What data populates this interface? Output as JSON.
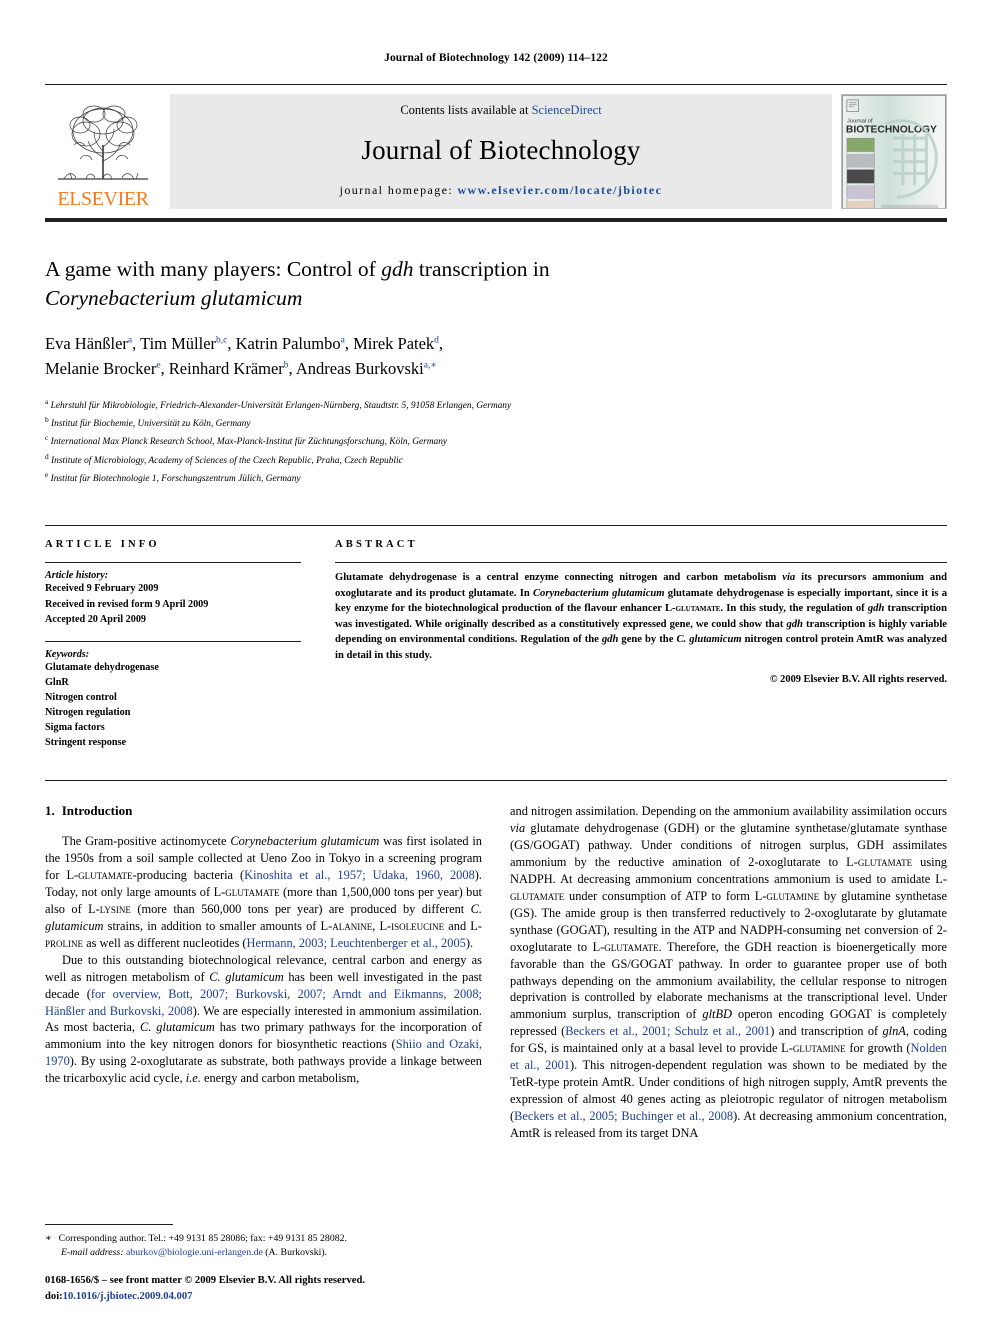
{
  "running_head": "Journal of Biotechnology 142 (2009) 114–122",
  "masthead": {
    "publisher_name": "ELSEVIER",
    "contents_prefix": "Contents lists available at ",
    "contents_link": "ScienceDirect",
    "journal_title": "Journal of Biotechnology",
    "homepage_prefix": "journal homepage: ",
    "homepage_url": "www.elsevier.com/locate/jbiotec",
    "cover": {
      "line1": "Journal of",
      "line2": "BIOTECHNOLOGY"
    }
  },
  "article": {
    "title_line1_a": "A game with many players: Control of ",
    "title_line1_it": "gdh",
    "title_line1_b": " transcription in",
    "title_line2_it": "Corynebacterium glutamicum",
    "authors_line1": [
      {
        "name": "Eva Hänßler",
        "sup": "a",
        "sep": ", "
      },
      {
        "name": "Tim Müller",
        "sup": "b,c",
        "sep": ", "
      },
      {
        "name": "Katrin Palumbo",
        "sup": "a",
        "sep": ", "
      },
      {
        "name": "Mirek Patek",
        "sup": "d",
        "sep": ","
      }
    ],
    "authors_line2": [
      {
        "name": "Melanie Brocker",
        "sup": "e",
        "sep": ", "
      },
      {
        "name": "Reinhard Krämer",
        "sup": "b",
        "sep": ", "
      },
      {
        "name": "Andreas Burkovski",
        "sup": "a,∗",
        "sep": ""
      }
    ],
    "affiliations": [
      {
        "label": "a",
        "text": "Lehrstuhl für Mikrobiologie, Friedrich-Alexander-Universität Erlangen-Nürnberg, Staudtstr. 5, 91058 Erlangen, Germany"
      },
      {
        "label": "b",
        "text": "Institut für Biochemie, Universität zu Köln, Germany"
      },
      {
        "label": "c",
        "text": "International Max Planck Research School, Max-Planck-Institut für Züchtungsforschung, Köln, Germany"
      },
      {
        "label": "d",
        "text": "Institute of Microbiology, Academy of Sciences of the Czech Republic, Praha, Czech Republic"
      },
      {
        "label": "e",
        "text": "Institut für Biotechnologie 1, Forschungszentrum Jülich, Germany"
      }
    ]
  },
  "info": {
    "heading": "ARTICLE INFO",
    "history_label": "Article history:",
    "history": [
      "Received 9 February 2009",
      "Received in revised form 9 April 2009",
      "Accepted 20 April 2009"
    ],
    "keywords_label": "Keywords:",
    "keywords": [
      "Glutamate dehydrogenase",
      "GlnR",
      "Nitrogen control",
      "Nitrogen regulation",
      "Sigma factors",
      "Stringent response"
    ]
  },
  "abstract": {
    "heading": "ABSTRACT",
    "paragraph": "Glutamate dehydrogenase is a central enzyme connecting nitrogen and carbon metabolism via its precursors ammonium and oxoglutarate and its product glutamate. In Corynebacterium glutamicum glutamate dehydrogenase is especially important, since it is a key enzyme for the biotechnological production of the flavour enhancer L-glutamate. In this study, the regulation of gdh transcription was investigated. While originally described as a constitutively expressed gene, we could show that gdh transcription is highly variable depending on environmental conditions. Regulation of the gdh gene by the C. glutamicum nitrogen control protein AmtR was analyzed in detail in this study.",
    "copyright": "© 2009 Elsevier B.V. All rights reserved."
  },
  "body": {
    "section_number": "1.",
    "section_title": "Introduction",
    "left_paragraphs": [
      "The Gram-positive actinomycete Corynebacterium glutamicum was first isolated in the 1950s from a soil sample collected at Ueno Zoo in Tokyo in a screening program for L-glutamate-producing bacteria (Kinoshita et al., 1957; Udaka, 1960, 2008). Today, not only large amounts of L-glutamate (more than 1,500,000 tons per year) but also of L-lysine (more than 560,000 tons per year) are produced by different C. glutamicum strains, in addition to smaller amounts of L-alanine, L-isoleucine and L-proline as well as different nucleotides (Hermann, 2003; Leuchtenberger et al., 2005).",
      "Due to this outstanding biotechnological relevance, central carbon and energy as well as nitrogen metabolism of C. glutamicum has been well investigated in the past decade (for overview, Bott, 2007; Burkovski, 2007; Arndt and Eikmanns, 2008; Hänßler and Burkovski, 2008). We are especially interested in ammonium assimilation. As most bacteria, C. glutamicum has two primary pathways for the incorporation of ammonium into the key nitrogen donors for biosynthetic reactions (Shiio and Ozaki, 1970). By using 2-oxoglutarate as substrate, both pathways provide a linkage between the tricarboxylic acid cycle, i.e. energy and carbon metabolism,"
    ],
    "right_paragraph": "and nitrogen assimilation. Depending on the ammonium availability assimilation occurs via glutamate dehydrogenase (GDH) or the glutamine synthetase/glutamate synthase (GS/GOGAT) pathway. Under conditions of nitrogen surplus, GDH assimilates ammonium by the reductive amination of 2-oxoglutarate to L-glutamate using NADPH. At decreasing ammonium concentrations ammonium is used to amidate L-glutamate under consumption of ATP to form L-glutamine by glutamine synthetase (GS). The amide group is then transferred reductively to 2-oxoglutarate by glutamate synthase (GOGAT), resulting in the ATP and NADPH-consuming net conversion of 2-oxoglutarate to L-glutamate. Therefore, the GDH reaction is bioenergetically more favorable than the GS/GOGAT pathway. In order to guarantee proper use of both pathways depending on the ammonium availability, the cellular response to nitrogen deprivation is controlled by elaborate mechanisms at the transcriptional level. Under ammonium surplus, transcription of gltBD operon encoding GOGAT is completely repressed (Beckers et al., 2001; Schulz et al., 2001) and transcription of glnA, coding for GS, is maintained only at a basal level to provide L-glutamine for growth (Nolden et al., 2001). This nitrogen-dependent regulation was shown to be mediated by the TetR-type protein AmtR. Under conditions of high nitrogen supply, AmtR prevents the expression of almost 40 genes acting as pleiotropic regulator of nitrogen metabolism (Beckers et al., 2005; Buchinger et al., 2008). At decreasing ammonium concentration, AmtR is released from its target DNA"
  },
  "footnote": {
    "marker": "∗",
    "text": "Corresponding author. Tel.: +49 9131 85 28086; fax: +49 9131 85 28082.",
    "email_label": "E-mail address:",
    "email": "aburkov@biologie.uni-erlangen.de",
    "email_suffix": " (A. Burkovski)."
  },
  "imprint": {
    "line1": "0168-1656/$ – see front matter © 2009 Elsevier B.V. All rights reserved.",
    "doi_label": "doi:",
    "doi": "10.1016/j.jbiotec.2009.04.007"
  },
  "colors": {
    "link_blue": "#1c3f94",
    "sciencedirect_blue": "#1c4b9c",
    "elsevier_orange": "#f47a20",
    "band_grey": "#e9e9e9"
  }
}
